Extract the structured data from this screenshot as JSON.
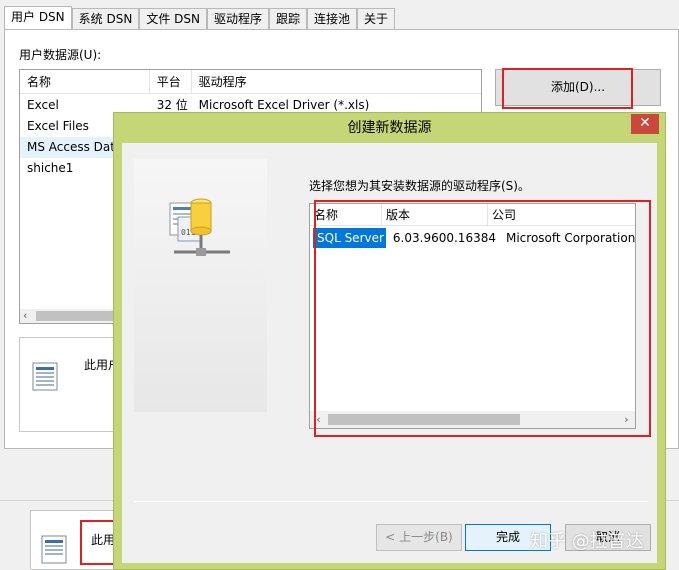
{
  "odbc": {
    "tabs": [
      {
        "label": "用户 DSN",
        "active": true
      },
      {
        "label": "系统 DSN"
      },
      {
        "label": "文件 DSN"
      },
      {
        "label": "驱动程序"
      },
      {
        "label": "跟踪"
      },
      {
        "label": "连接池"
      },
      {
        "label": "关于"
      }
    ],
    "user_ds_label": "用户数据源(U):",
    "columns": [
      "名称",
      "平台",
      "驱动程序"
    ],
    "rows": [
      {
        "name": "Excel",
        "platform": "32 位",
        "driver": "Microsoft Excel Driver (*.xls)"
      },
      {
        "name": "Excel Files",
        "platform": "",
        "driver": ""
      },
      {
        "name": "MS Access Dat",
        "platform": "",
        "driver": ""
      },
      {
        "name": "shiche1",
        "platform": "",
        "driver": ""
      }
    ],
    "add_button": "添加(D)...",
    "desc_text": "此用户",
    "bottom_text": "此用"
  },
  "new_ds_dialog": {
    "title": "创建新数据源",
    "close_glyph": "✕",
    "prompt": "选择您想为其安装数据源的驱动程序(S)。",
    "columns": [
      "名称",
      "版本",
      "公司"
    ],
    "drivers": [
      {
        "name": "SQL Server",
        "version": "6.03.9600.16384",
        "company": "Microsoft Corporation"
      }
    ],
    "back_button": "< 上一步(B)",
    "finish_button": "完成",
    "cancel_button": "取消"
  },
  "watermark": "知乎 @拉普达",
  "colors": {
    "highlight_box": "#e02020",
    "dialog_frame": "#c5d676",
    "selection": "#0078d7"
  },
  "icons": [
    "data-sources-icon",
    "database-network-icon",
    "close-icon",
    "chevron-left-icon",
    "chevron-right-icon"
  ]
}
